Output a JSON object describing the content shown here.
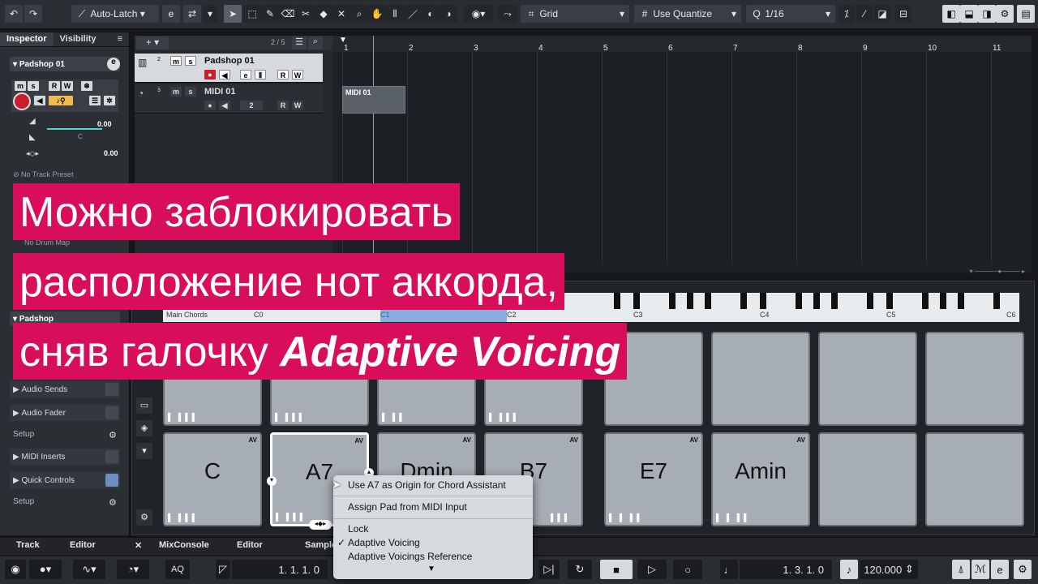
{
  "toolbar": {
    "automation": "Auto-Latch",
    "snap_type": "Grid",
    "quantize_mode": "Use Quantize",
    "quantize_value": "1/16"
  },
  "inspector": {
    "tabs": [
      "Inspector",
      "Visibility"
    ],
    "track_name": "Padshop 01",
    "vol_value": "0.00",
    "pan_value": "C",
    "delay_value": "0.00",
    "preset": "No Track Preset",
    "drum_map": "No Drum Map",
    "instrument": "Padshop",
    "sections": [
      "Audio Sends",
      "Audio Fader",
      "MIDI Inserts",
      "Quick Controls"
    ],
    "setup": "Setup"
  },
  "tracks": {
    "count": "2 / 5",
    "rows": [
      {
        "num": "2",
        "name": "Padshop 01"
      },
      {
        "num": "3",
        "name": "MIDI 01",
        "channel": "2"
      }
    ]
  },
  "arranger": {
    "bars": [
      "1",
      "2",
      "3",
      "4",
      "5",
      "6",
      "7",
      "8",
      "9",
      "10",
      "11"
    ],
    "clip_label": "MIDI 01"
  },
  "chordpads": {
    "keys": [
      "C0",
      "C1",
      "C2",
      "C3",
      "C4",
      "C5",
      "C6"
    ],
    "row_label": "Main Chords",
    "bottom_row": [
      {
        "label": "C",
        "av": "AV"
      },
      {
        "label": "A7",
        "av": "AV"
      },
      {
        "label": "Dmin",
        "av": "AV"
      },
      {
        "label": "B7",
        "av": "AV"
      },
      {
        "label": "E7",
        "av": "AV"
      },
      {
        "label": "Amin",
        "av": "AV"
      },
      {
        "label": "",
        "av": ""
      },
      {
        "label": "",
        "av": ""
      }
    ]
  },
  "context_menu": {
    "items": [
      "Use A7 as Origin for Chord Assistant",
      "Assign Pad from MIDI Input",
      "Lock",
      "Adaptive Voicing",
      "Adaptive Voicings Reference"
    ],
    "checked": "✓"
  },
  "bottom_tabs": [
    "Track",
    "Editor",
    "MixConsole",
    "Editor",
    "Sampler"
  ],
  "transport": {
    "left_locator": "1. 1. 1.   0",
    "position": "1. 3. 1.   0",
    "tempo": "120.000",
    "aq": "AQ"
  },
  "overlay": {
    "line1": "Можно заблокировать",
    "line2": "расположение нот аккорда,",
    "line3a": "сняв галочку ",
    "line3b": "Adaptive Voicing"
  },
  "colors": {
    "overlay": "#d80e5b",
    "record": "#c81e2e",
    "accent": "#3a7bd5"
  }
}
